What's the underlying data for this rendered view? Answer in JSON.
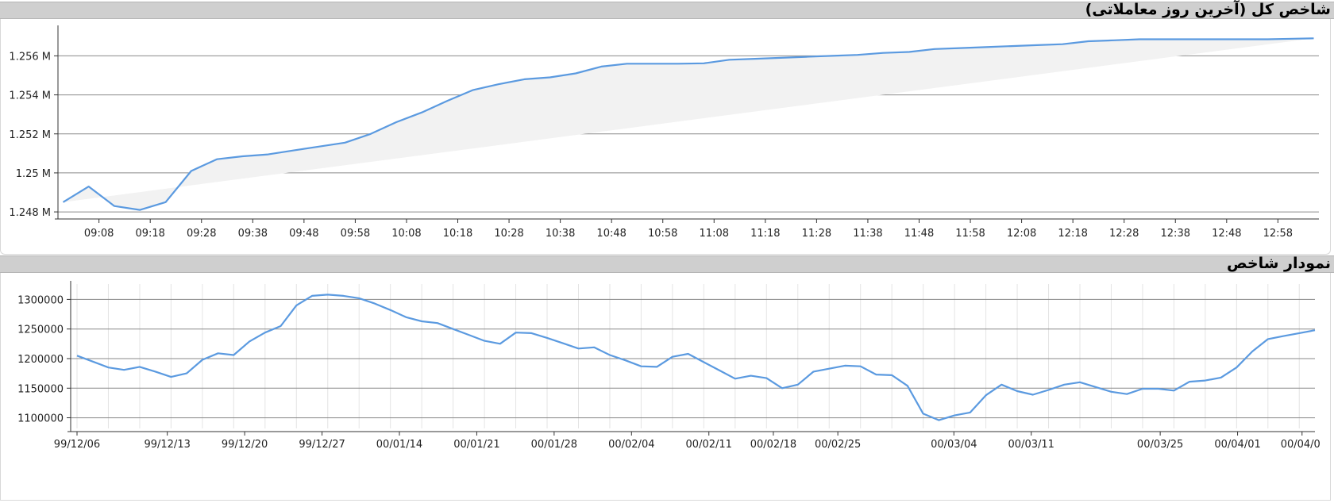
{
  "panels": [
    {
      "title": "شاخص کل (آخرین روز معاملاتی)"
    },
    {
      "title": "نمودار شاخص"
    }
  ],
  "chart_data": [
    {
      "type": "area",
      "ylim": [
        1247800,
        1257400
      ],
      "y_ticks": [
        {
          "value": 1248000,
          "label": "1.248 M"
        },
        {
          "value": 1250000,
          "label": "1.25 M"
        },
        {
          "value": 1252000,
          "label": "1.252 M"
        },
        {
          "value": 1254000,
          "label": "1.254 M"
        },
        {
          "value": 1256000,
          "label": "1.256 M"
        }
      ],
      "x_start": "09:00",
      "x_end": "13:06",
      "x_ticks": [
        "09:08",
        "09:18",
        "09:28",
        "09:38",
        "09:48",
        "09:58",
        "10:08",
        "10:18",
        "10:28",
        "10:38",
        "10:48",
        "10:58",
        "11:08",
        "11:18",
        "11:28",
        "11:38",
        "11:48",
        "11:58",
        "12:08",
        "12:18",
        "12:28",
        "12:38",
        "12:48",
        "12:58"
      ],
      "series": [
        {
          "color": "#5b9ae0",
          "x": [
            "09:01",
            "09:06",
            "09:11",
            "09:16",
            "09:21",
            "09:26",
            "09:31",
            "09:36",
            "09:41",
            "09:46",
            "09:51",
            "09:56",
            "10:01",
            "10:06",
            "10:11",
            "10:16",
            "10:21",
            "10:26",
            "10:31",
            "10:36",
            "10:41",
            "10:46",
            "10:51",
            "10:56",
            "11:01",
            "11:06",
            "11:11",
            "11:16",
            "11:21",
            "11:26",
            "11:31",
            "11:36",
            "11:41",
            "11:46",
            "11:51",
            "11:56",
            "12:01",
            "12:06",
            "12:11",
            "12:16",
            "12:21",
            "12:26",
            "12:31",
            "12:36",
            "12:41",
            "12:46",
            "12:51",
            "12:56",
            "13:01",
            "13:05"
          ],
          "y": [
            1248500,
            1249300,
            1248300,
            1248100,
            1248500,
            1250100,
            1250700,
            1250850,
            1250950,
            1251150,
            1251350,
            1251550,
            1252000,
            1252600,
            1253100,
            1253700,
            1254250,
            1254550,
            1254800,
            1254900,
            1255100,
            1255450,
            1255600,
            1255600,
            1255600,
            1255620,
            1255800,
            1255850,
            1255900,
            1255950,
            1256000,
            1256050,
            1256150,
            1256200,
            1256350,
            1256400,
            1256450,
            1256500,
            1256550,
            1256600,
            1256750,
            1256800,
            1256850,
            1256850,
            1256850,
            1256850,
            1256850,
            1256850,
            1256880,
            1256900
          ]
        }
      ],
      "grid": "horizontal"
    },
    {
      "type": "line",
      "ylim": [
        1082000,
        1326000
      ],
      "y_ticks": [
        1100000,
        1150000,
        1200000,
        1250000,
        1300000
      ],
      "x_tick_labels": [
        "99/12/06",
        "99/12/13",
        "99/12/20",
        "99/12/27",
        "00/01/14",
        "00/01/21",
        "00/01/28",
        "00/02/04",
        "00/02/11",
        "00/02/18",
        "00/02/25",
        "00/03/04",
        "00/03/11",
        "00/03/25",
        "00/04/01",
        "00/04/0"
      ],
      "series": [
        {
          "color": "#5b9ae0",
          "values": [
            1205000,
            1195000,
            1185000,
            1181000,
            1186000,
            1178000,
            1169000,
            1175000,
            1198000,
            1209000,
            1206000,
            1229000,
            1244000,
            1255000,
            1290000,
            1306000,
            1308000,
            1306000,
            1302000,
            1293000,
            1282000,
            1270000,
            1263000,
            1260000,
            1250000,
            1240000,
            1230000,
            1225000,
            1244000,
            1243000,
            1235000,
            1226000,
            1217000,
            1219000,
            1206000,
            1197000,
            1187000,
            1186000,
            1203000,
            1208000,
            1194000,
            1180000,
            1166000,
            1171000,
            1167000,
            1150000,
            1156000,
            1178000,
            1183000,
            1188000,
            1187000,
            1173000,
            1172000,
            1154000,
            1107000,
            1096000,
            1104000,
            1109000,
            1138000,
            1156000,
            1145000,
            1139000,
            1147000,
            1156000,
            1160000,
            1152000,
            1144000,
            1140000,
            1149000,
            1149000,
            1146000,
            1161000,
            1163000,
            1168000,
            1185000,
            1212000,
            1233000,
            1238000,
            1243000,
            1248000
          ]
        }
      ],
      "grid": "both"
    }
  ]
}
